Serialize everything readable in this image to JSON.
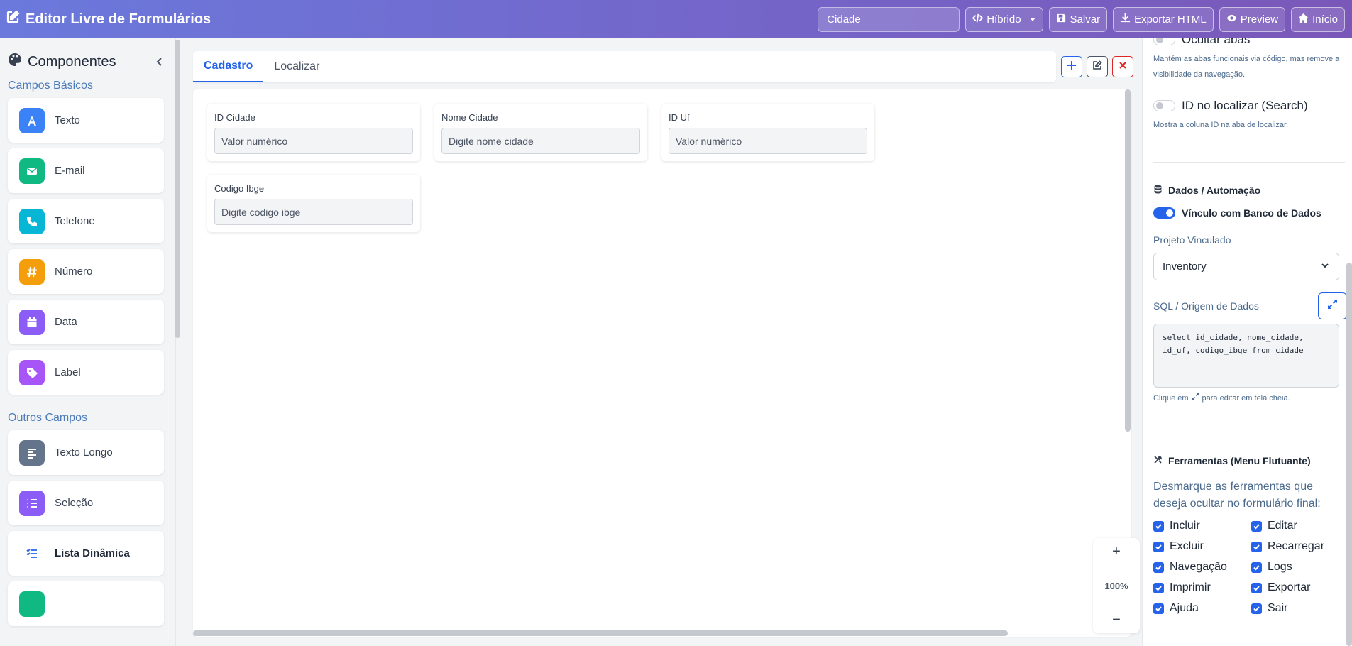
{
  "header": {
    "title": "Editor Livre de Formulários",
    "form_name_value": "Cidade",
    "mode_label": "Híbrido",
    "save_label": "Salvar",
    "export_label": "Exportar HTML",
    "preview_label": "Preview",
    "home_label": "Início"
  },
  "sidebar": {
    "title": "Componentes",
    "sections": [
      {
        "title": "Campos Básicos",
        "items": [
          {
            "label": "Texto",
            "icon": "font-icon",
            "color": "#3b82f6"
          },
          {
            "label": "E-mail",
            "icon": "envelope-icon",
            "color": "#10b981"
          },
          {
            "label": "Telefone",
            "icon": "phone-icon",
            "color": "#06b6d4"
          },
          {
            "label": "Número",
            "icon": "hash-icon",
            "color": "#f59e0b"
          },
          {
            "label": "Data",
            "icon": "calendar-icon",
            "color": "#8b5cf6"
          },
          {
            "label": "Label",
            "icon": "tag-icon",
            "color": "#a855f7"
          }
        ]
      },
      {
        "title": "Outros Campos",
        "items": [
          {
            "label": "Texto Longo",
            "icon": "align-left-icon",
            "color": "#64748b"
          },
          {
            "label": "Seleção",
            "icon": "list-icon",
            "color": "#8b5cf6"
          },
          {
            "label": "Lista Dinâmica",
            "icon": "list-check-icon",
            "color": "#2563eb"
          }
        ]
      }
    ]
  },
  "tabs": [
    {
      "label": "Cadastro",
      "active": true
    },
    {
      "label": "Localizar",
      "active": false
    }
  ],
  "fields": [
    {
      "label": "ID Cidade",
      "placeholder": "Valor numérico"
    },
    {
      "label": "Nome Cidade",
      "placeholder": "Digite nome cidade"
    },
    {
      "label": "ID Uf",
      "placeholder": "Valor numérico"
    },
    {
      "label": "Codigo Ibge",
      "placeholder": "Digite codigo ibge"
    }
  ],
  "zoom": {
    "plus": "+",
    "value": "100%",
    "minus": "−"
  },
  "settings": {
    "hide_tabs_label": "Ocultar abas",
    "hide_tabs_hint": "Mantém as abas funcionais via código, mas remove a visibilidade da navegação.",
    "id_search_label": "ID no localizar (Search)",
    "id_search_hint": "Mostra a coluna ID na aba de localizar.",
    "data_section_title": "Dados / Automação",
    "db_link_label": "Vínculo com Banco de Dados",
    "project_label": "Projeto Vinculado",
    "project_value": "Inventory",
    "sql_label": "SQL / Origem de Dados",
    "sql_value": "select id_cidade, nome_cidade, id_uf, codigo_ibge from cidade",
    "sql_hint_before": "Clique em",
    "sql_hint_after": "para editar em tela cheia.",
    "tools_section_title": "Ferramentas (Menu Flutuante)",
    "tools_text": "Desmarque as ferramentas que deseja ocultar no formulário final:",
    "tools": [
      "Incluir",
      "Editar",
      "Excluir",
      "Recarregar",
      "Navegação",
      "Logs",
      "Imprimir",
      "Exportar",
      "Ajuda",
      "Sair"
    ]
  }
}
